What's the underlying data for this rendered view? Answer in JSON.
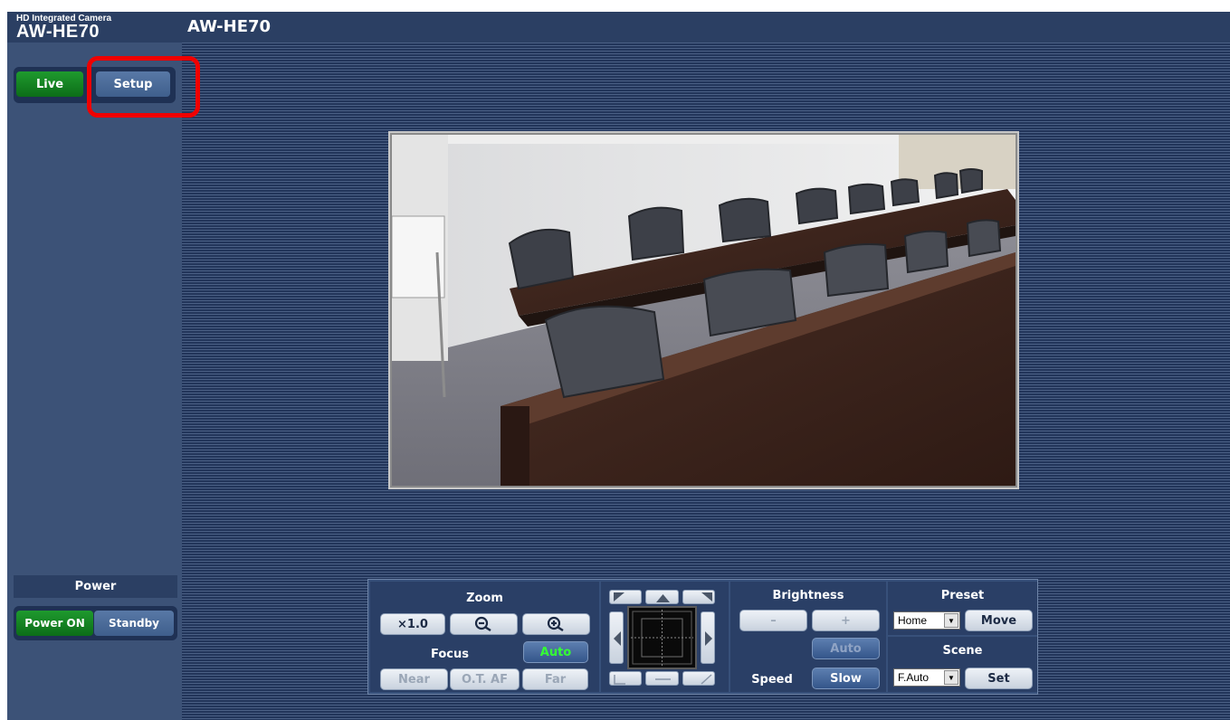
{
  "header": {
    "brand_sub": "HD Integrated Camera",
    "brand_model": "AW-HE70",
    "title": "AW-HE70"
  },
  "sidebar": {
    "mode_tabs": {
      "live": "Live",
      "setup": "Setup",
      "active": "Live"
    },
    "power": {
      "label": "Power",
      "on": "Power ON",
      "standby": "Standby",
      "active": "Power ON"
    }
  },
  "controls": {
    "zoom": {
      "label": "Zoom",
      "x1": "×1.0"
    },
    "focus": {
      "label": "Focus",
      "auto": "Auto",
      "near": "Near",
      "otaf": "O.T. AF",
      "far": "Far"
    },
    "brightness": {
      "label": "Brightness",
      "minus": "–",
      "plus": "+",
      "auto": "Auto"
    },
    "speed": {
      "label": "Speed",
      "value": "Slow"
    },
    "preset": {
      "label": "Preset",
      "selected": "Home",
      "move": "Move"
    },
    "scene": {
      "label": "Scene",
      "selected": "F.Auto",
      "set": "Set"
    }
  },
  "colors": {
    "highlight": "#f00000",
    "active_green": "#0c6d18",
    "focus_auto_text": "#34ff34"
  }
}
